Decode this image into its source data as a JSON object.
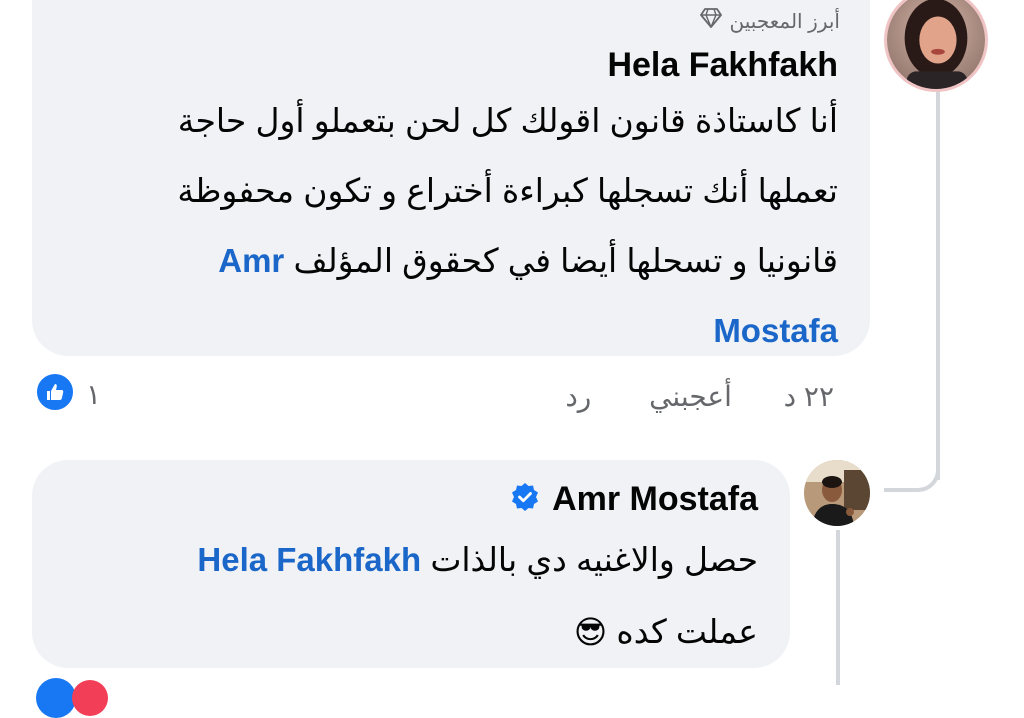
{
  "comment1": {
    "badge_label": "أبرز المعجبين",
    "author": "Hela Fakhfakh",
    "text_line1": "أنا كاستاذة قانون اقولك كل لحن بتعملو أول حاجة",
    "text_line2": "تعملها أنك  تسجلها كبراءة أختراع و تكون محفوظة",
    "text_line3": "قانونيا و تسحلها أيضا في كحقوق المؤلف",
    "mention_part1": "Amr",
    "mention_part2": "Mostafa",
    "time": "٢٢ د",
    "like_label": "أعجبني",
    "reply_label": "رد",
    "reaction_count": "١"
  },
  "comment2": {
    "author": "Amr Mostafa",
    "verified": true,
    "mention": "Hela Fakhfakh",
    "text_line1": "حصل والاغنيه دي بالذات",
    "text_line2": "عملت كده",
    "emoji": "😎"
  },
  "colors": {
    "bubble": "#f0f2f5",
    "mention": "#1b66c9",
    "meta": "#65676b",
    "like_blue": "#1877f2"
  }
}
